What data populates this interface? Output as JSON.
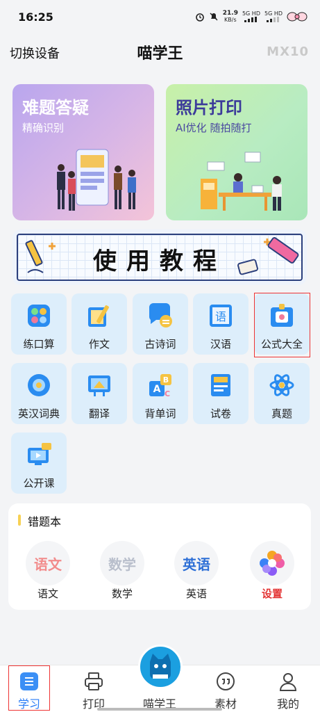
{
  "status": {
    "time": "16:25",
    "speed_value": "21.9",
    "speed_unit": "KB/s",
    "sig1": "5G HD",
    "sig2": "5G HD"
  },
  "header": {
    "switch_device": "切换设备",
    "title": "喵学王",
    "model": "MX10"
  },
  "cards": {
    "qa": {
      "title": "难题答疑",
      "subtitle": "精确识别"
    },
    "photo": {
      "title": "照片打印",
      "subtitle": "AI优化 随拍随打"
    }
  },
  "tutorial": {
    "label": "使用教程"
  },
  "tools": [
    {
      "label": "练口算",
      "icon": "calculator-icon"
    },
    {
      "label": "作文",
      "icon": "pencil-book-icon"
    },
    {
      "label": "古诗词",
      "icon": "chat-bubble-icon"
    },
    {
      "label": "汉语",
      "icon": "chinese-char-icon"
    },
    {
      "label": "公式大全",
      "icon": "formula-card-icon"
    },
    {
      "label": "英汉词典",
      "icon": "dictionary-icon"
    },
    {
      "label": "翻译",
      "icon": "translate-board-icon"
    },
    {
      "label": "背单词",
      "icon": "abc-blocks-icon"
    },
    {
      "label": "试卷",
      "icon": "test-paper-icon"
    },
    {
      "label": "真题",
      "icon": "atom-icon"
    },
    {
      "label": "公开课",
      "icon": "video-lesson-icon"
    }
  ],
  "mistakes": {
    "title": "错题本",
    "subjects": [
      {
        "badge": "语文",
        "label": "语文",
        "color": "#f28b8b"
      },
      {
        "badge": "数学",
        "label": "数学",
        "color": "#b9bfcc"
      },
      {
        "badge": "英语",
        "label": "英语",
        "color": "#2d6fd6"
      },
      {
        "badge": "",
        "label": "设置",
        "color": "#e33333"
      }
    ]
  },
  "nav": {
    "study": "学习",
    "print": "打印",
    "center": "喵学王",
    "material": "素材",
    "mine": "我的"
  },
  "colors": {
    "accent": "#2a7cf6",
    "tile_bg": "#ddeefb",
    "highlight": "#e33333"
  }
}
